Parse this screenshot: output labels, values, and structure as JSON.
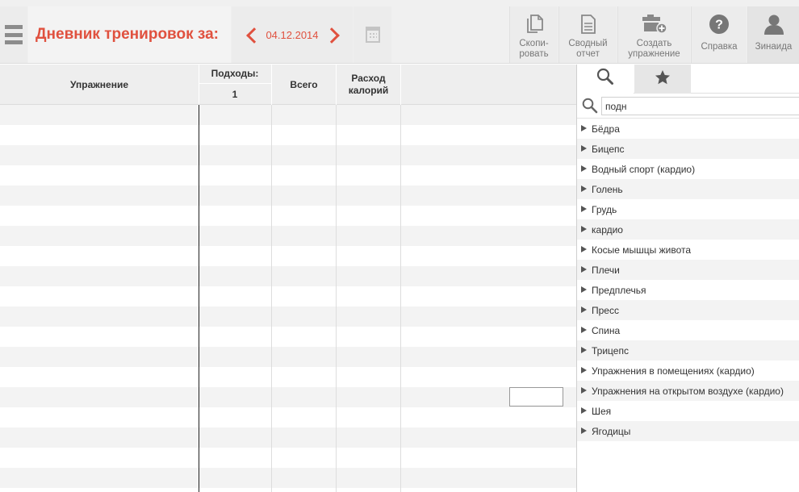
{
  "header": {
    "title": "Дневник тренировок за:",
    "date": "04.12.2014",
    "buttons": {
      "copy_l1": "Скопи-",
      "copy_l2": "ровать",
      "report_l1": "Сводный",
      "report_l2": "отчет",
      "create_l1": "Создать",
      "create_l2": "упражнение",
      "help": "Справка",
      "user": "Зинаида"
    }
  },
  "table": {
    "columns": {
      "exercise": "Упражнение",
      "sets": "Подходы:",
      "set_number": "1",
      "total": "Всего",
      "calories_l1": "Расход",
      "calories_l2": "калорий"
    }
  },
  "panel": {
    "search_value": "подн",
    "categories": [
      "Бёдра",
      "Бицепс",
      "Водный спорт (кардио)",
      "Голень",
      "Грудь",
      "кардио",
      "Косые мышцы живота",
      "Плечи",
      "Предплечья",
      "Пресс",
      "Спина",
      "Трицепс",
      "Упражнения в помещениях  (кардио)",
      "Упражнения на открытом воздухе (кардио)",
      "Шея",
      "Ягодицы"
    ]
  },
  "colors": {
    "accent": "#e0513f",
    "toolbar": "#ececec",
    "row_stripe": "#f3f3f3"
  },
  "icons": [
    "menu-icon",
    "chevron-left-icon",
    "chevron-right-icon",
    "calendar-icon",
    "copy-icon",
    "report-icon",
    "create-exercise-icon",
    "help-icon",
    "user-icon",
    "search-icon",
    "star-icon",
    "triangle-right-icon"
  ]
}
